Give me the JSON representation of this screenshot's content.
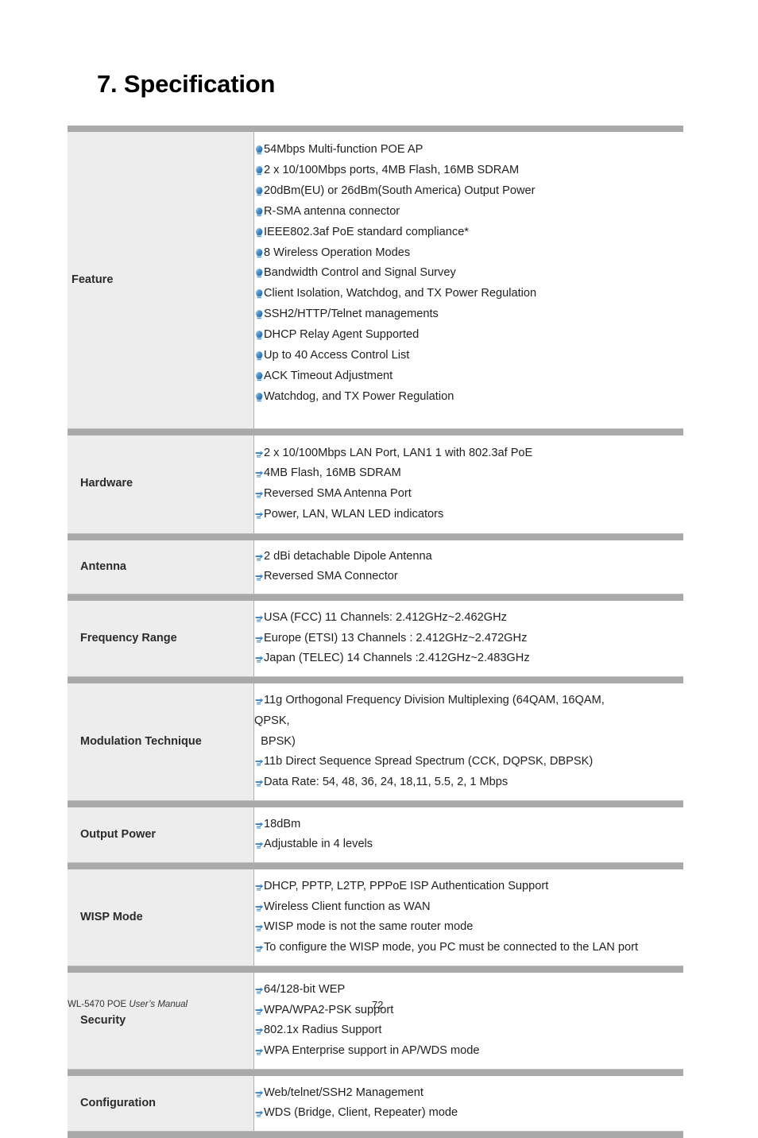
{
  "heading": "7. Specification",
  "bullet_icon_primary": "blue-globe-bullet-icon",
  "bullet_icon_secondary": "blue-arrow-bullet-icon",
  "colors": {
    "separator_bar": "#a9a9a9",
    "label_cell_bg": "#ededed",
    "content_cell_bg": "#ffffff",
    "cell_border": "#b0b0b0",
    "bullet_blue": "#2f7fc4",
    "text": "#1f1f1f"
  },
  "table": {
    "rows": [
      {
        "label": "Feature",
        "bullet_style": "globe",
        "items": [
          "54Mbps Multi-function POE AP",
          "2 x 10/100Mbps ports, 4MB Flash, 16MB SDRAM",
          "20dBm(EU) or 26dBm(South America) Output Power",
          "R-SMA antenna connector",
          "IEEE802.3af PoE standard compliance*",
          "8 Wireless Operation Modes",
          "Bandwidth Control and Signal Survey",
          "Client Isolation, Watchdog, and TX Power Regulation",
          "SSH2/HTTP/Telnet managements",
          "DHCP Relay Agent Supported",
          "Up to 40 Access Control List",
          "ACK Timeout Adjustment",
          "Watchdog, and TX Power Regulation"
        ]
      },
      {
        "label": "Hardware",
        "bullet_style": "arrow",
        "items": [
          "2 x 10/100Mbps LAN Port, LAN1 1 with 802.3af PoE",
          "4MB Flash, 16MB SDRAM",
          "Reversed SMA Antenna Port",
          "Power, LAN, WLAN LED indicators"
        ]
      },
      {
        "label": "Antenna",
        "bullet_style": "arrow",
        "items": [
          "2 dBi detachable Dipole Antenna",
          "Reversed SMA Connector"
        ]
      },
      {
        "label": "Frequency Range",
        "bullet_style": "arrow",
        "items": [
          "USA (FCC) 11 Channels: 2.412GHz~2.462GHz",
          "Europe (ETSI) 13 Channels : 2.412GHz~2.472GHz",
          "Japan (TELEC) 14 Channels :2.412GHz~2.483GHz"
        ]
      },
      {
        "label": "Modulation Technique",
        "bullet_style": "arrow",
        "items": [
          "11g Orthogonal Frequency Division Multiplexing (64QAM, 16QAM,",
          "11b Direct Sequence Spread Spectrum (CCK, DQPSK, DBPSK)",
          "Data Rate: 54, 48, 36, 24, 18,11, 5.5, 2, 1 Mbps"
        ],
        "wrap_lines": [
          "QPSK,",
          "  BPSK)"
        ]
      },
      {
        "label": "Output Power",
        "bullet_style": "arrow",
        "items": [
          "18dBm",
          "Adjustable in 4 levels"
        ]
      },
      {
        "label": "WISP Mode",
        "bullet_style": "arrow",
        "items": [
          "DHCP, PPTP, L2TP, PPPoE ISP Authentication Support",
          "Wireless Client function as WAN",
          "WISP mode is not the same router mode",
          "To configure the WISP mode, you PC must be connected to the LAN port"
        ]
      },
      {
        "label": "Security",
        "bullet_style": "arrow",
        "items": [
          "64/128-bit WEP",
          "WPA/WPA2-PSK support",
          "802.1x Radius Support",
          "WPA Enterprise support in AP/WDS mode"
        ]
      },
      {
        "label": "Configuration",
        "bullet_style": "arrow",
        "items": [
          "Web/telnet/SSH2 Management",
          "WDS (Bridge, Client, Repeater) mode"
        ]
      }
    ]
  },
  "footer": {
    "product": "WL-5470 POE ",
    "manual": "User’s Manual",
    "page_number": "72"
  }
}
